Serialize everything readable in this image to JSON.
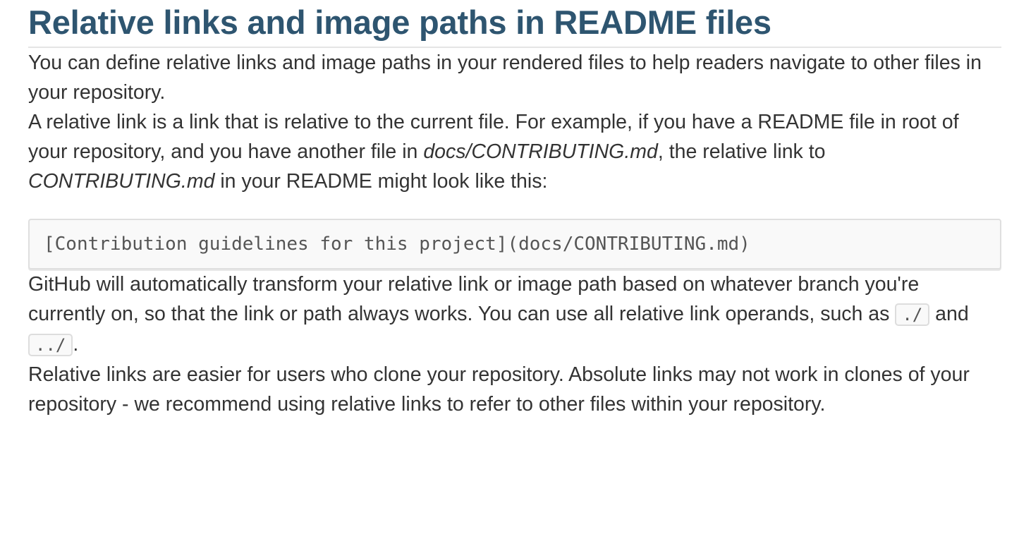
{
  "title": "Relative links and image paths in README files",
  "paragraph1": "You can define relative links and image paths in your rendered files to help readers navigate to other files in your repository.",
  "paragraph2": {
    "part1": "A relative link is a link that is relative to the current file. For example, if you have a README file in root of your repository, and you have another file in ",
    "em1": "docs/CONTRIBUTING.md",
    "part2": ", the relative link to ",
    "em2": "CONTRIBUTING.md",
    "part3": " in your README might look like this:"
  },
  "code_example": "[Contribution guidelines for this project](docs/CONTRIBUTING.md)",
  "paragraph3": {
    "part1": "GitHub will automatically transform your relative link or image path based on whatever branch you're currently on, so that the link or path always works. You can use all relative link operands, such as ",
    "code1": "./",
    "part2": " and ",
    "code2": "../",
    "part3": "."
  },
  "paragraph4": "Relative links are easier for users who clone your repository. Absolute links may not work in clones of your repository - we recommend using relative links to refer to other files within your repository."
}
